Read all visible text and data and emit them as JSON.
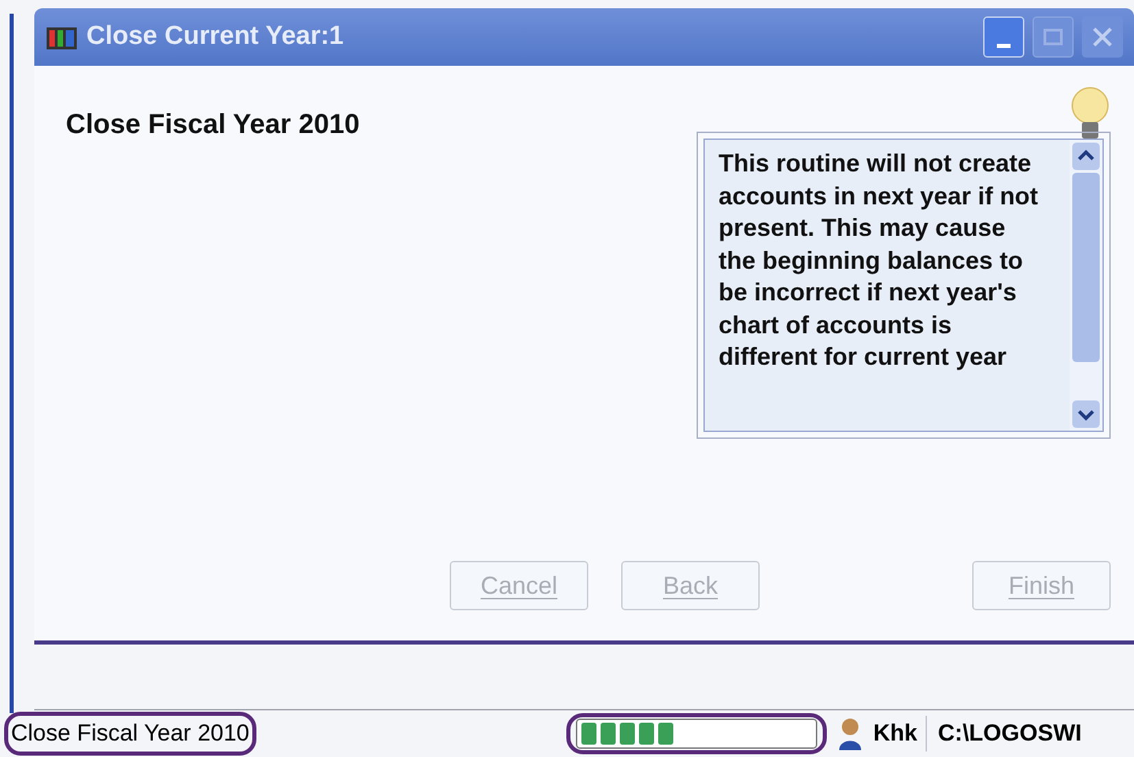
{
  "window": {
    "title": "Close Current Year:1"
  },
  "heading": "Close Fiscal Year 2010",
  "note": {
    "text": "This routine will not create accounts in next year if not present.  This may cause the beginning balances to be incorrect if next year's chart of accounts is different for current year"
  },
  "buttons": [
    {
      "label": "Cancel",
      "disabled": true
    },
    {
      "label": "Back",
      "disabled": true
    },
    {
      "label": "Finish",
      "disabled": true
    }
  ],
  "status_bar": {
    "message": "Close Fiscal Year 2010",
    "progress": {
      "level": 0.38
    },
    "user": "Khk",
    "path": "C:\\LOGOSWI"
  }
}
